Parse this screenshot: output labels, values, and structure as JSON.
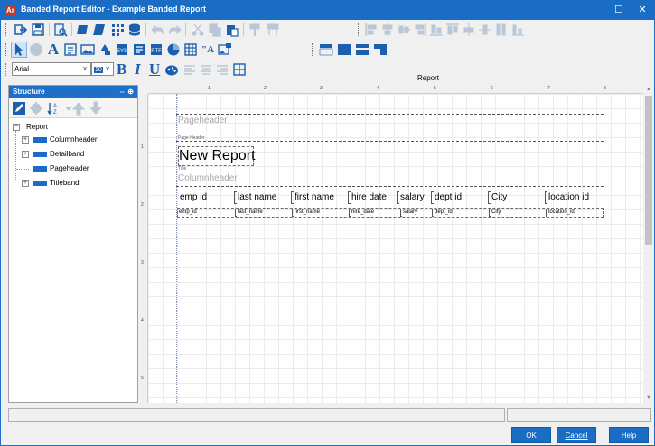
{
  "window": {
    "title": "Banded Report Editor - Example Banded Report",
    "app_icon_text": "Ar",
    "maximize_icon": "maximize-icon",
    "close_icon": "close-icon"
  },
  "toolbar": {
    "row1_icons": [
      "preview-icon",
      "save-icon",
      "print-preview-icon",
      "fields-icon",
      "edit-icon",
      "grid-icon",
      "database-icon",
      "undo-icon",
      "redo-icon",
      "cut-icon",
      "copy-icon",
      "paste-icon",
      "format-painter-icon",
      "page-setup-icon",
      "align-left-icon",
      "align-center-icon",
      "align-middle-icon",
      "align-right-icon",
      "align-bottom-icon",
      "align-top-icon",
      "center-horizontal-icon",
      "center-vertical-icon",
      "same-width-icon",
      "same-height-icon"
    ],
    "row2_icons": [
      "pointer-icon",
      "delete-icon",
      "text-icon",
      "field-icon",
      "image-icon",
      "shape-icon",
      "system-field-icon",
      "subreport-icon",
      "rtf-icon",
      "chart-icon",
      "table-icon",
      "label-icon",
      "picture-icon",
      "band-top-icon",
      "band-full-icon",
      "band-bottom-icon",
      "band-left-icon"
    ],
    "font_name": "Arial",
    "font_size": "10",
    "bold_label": "B",
    "italic_label": "I",
    "underline_label": "U",
    "report_label": "Report"
  },
  "structure": {
    "header": "Structure",
    "pin_icons": "⇔ ⊕",
    "tools": [
      "edit-icon",
      "settings-icon",
      "sort-icon",
      "move-up-icon",
      "move-down-icon"
    ],
    "root": "Report",
    "items": [
      {
        "label": "Columnheader",
        "expandable": true
      },
      {
        "label": "Detailband",
        "expandable": true
      },
      {
        "label": "Pageheader",
        "expandable": false
      },
      {
        "label": "Titleband",
        "expandable": true
      }
    ]
  },
  "ruler": {
    "top": [
      "1",
      "2",
      "3",
      "4",
      "5",
      "6",
      "7",
      "8"
    ],
    "left": [
      "1",
      "2",
      "3",
      "4",
      "5"
    ]
  },
  "report": {
    "pageheader_label": "Pageheader",
    "pageheader_tag": "Page Header",
    "title_text": "New Report",
    "title_tag": "Title",
    "columnheader_label": "Columnheader",
    "columns": [
      "emp id",
      "last name",
      "first name",
      "hire date",
      "salary",
      "dept id",
      "City",
      "location id"
    ],
    "fields": [
      "emp_id",
      "last_name",
      "first_name",
      "hire_date",
      "salary",
      "dept_id",
      "City",
      "location_id"
    ]
  },
  "buttons": {
    "ok": "OK",
    "cancel": "Cancel",
    "help": "Help"
  },
  "colors": {
    "accent": "#1a6dc4"
  }
}
